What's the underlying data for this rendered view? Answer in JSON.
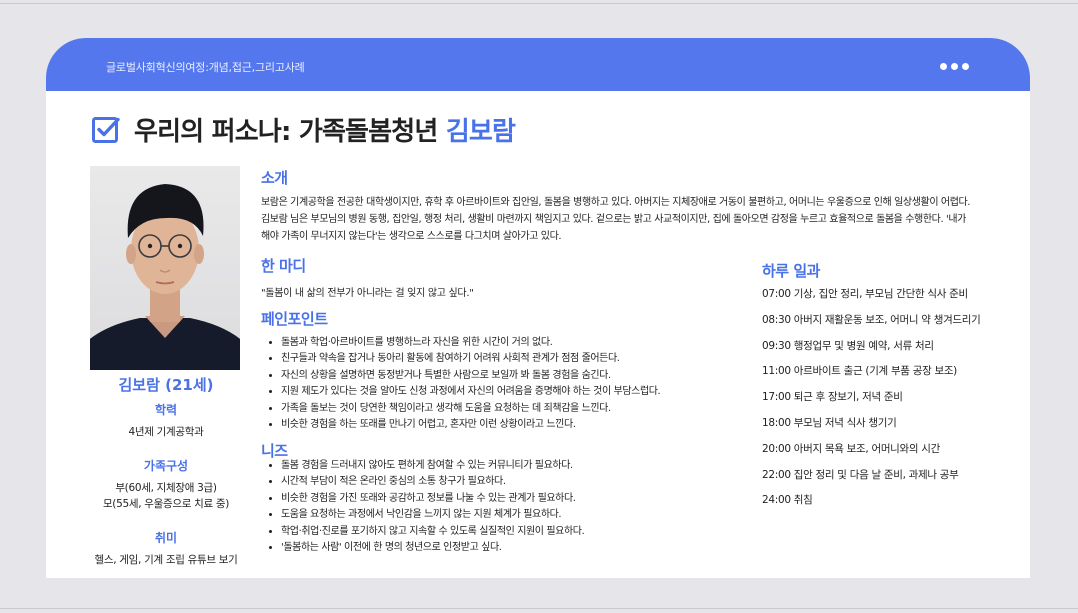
{
  "header": {
    "title": "글로벌사회혁신의여정:개념,접근,그리고사례",
    "menu_icon": "more-dots-icon"
  },
  "page": {
    "title_prefix": "우리의 퍼소나: 가족돌봄청년",
    "title_name": "김보람",
    "title_icon": "checkbox-checked-icon"
  },
  "profile": {
    "name": "김보람 (21세)",
    "education_label": "학력",
    "education": "4년제 기계공학과",
    "family_label": "가족구성",
    "family": [
      "부(60세, 지체장애 3급)",
      "모(55세, 우울증으로 치료 중)"
    ],
    "hobby_label": "취미",
    "hobby": "헬스, 게임, 기계 조립 유튜브 보기"
  },
  "intro": {
    "title": "소개",
    "text": "보람은 기계공학을 전공한 대학생이지만, 휴학 후 아르바이트와 집안일, 돌봄을 병행하고 있다. 아버지는 지체장애로 거동이 불편하고, 어머니는 우울증으로 인해 일상생활이 어렵다. 김보람 님은 부모님의 병원 동행, 집안일, 행정 처리, 생활비 마련까지 책임지고 있다. 겉으로는 밝고 사교적이지만, 집에 돌아오면 감정을 누르고 효율적으로 돌봄을 수행한다. '내가 해야 가족이 무너지지 않는다'는 생각으로 스스로를 다그치며 살아가고 있다."
  },
  "quote": {
    "title": "한 마디",
    "text": "\"돌봄이 내 삶의 전부가 아니라는 걸 잊지 않고 싶다.\""
  },
  "pain_points": {
    "title": "페인포인트",
    "items": [
      "돌봄과 학업·아르바이트를 병행하느라 자신을 위한 시간이 거의 없다.",
      "친구들과 약속을 잡거나 동아리 활동에 참여하기 어려워 사회적 관계가 점점 줄어든다.",
      "자신의 상황을 설명하면 동정받거나 특별한 사람으로 보일까 봐 돌봄 경험을 숨긴다.",
      "지원 제도가 있다는 것을 알아도 신청 과정에서 자신의 어려움을 증명해야 하는 것이 부담스럽다.",
      "가족을 돌보는 것이 당연한 책임이라고 생각해 도움을 요청하는 데 죄책감을 느낀다.",
      "비슷한 경험을 하는 또래를 만나기 어렵고, 혼자만 이런 상황이라고 느낀다."
    ]
  },
  "needs": {
    "title": "니즈",
    "items": [
      "돌봄 경험을 드러내지 않아도 편하게 참여할 수 있는 커뮤니티가 필요하다.",
      "시간적 부담이 적은 온라인 중심의 소통 창구가 필요하다.",
      "비슷한 경험을 가진 또래와 공감하고 정보를 나눌 수 있는 관계가 필요하다.",
      "도움을 요청하는 과정에서 낙인감을 느끼지 않는 지원 체계가 필요하다.",
      "학업·취업·진로를 포기하지 않고 지속할 수 있도록 실질적인 지원이 필요하다.",
      "'돌봄하는 사람' 이전에 한 명의 청년으로 인정받고 싶다."
    ]
  },
  "schedule": {
    "title": "하루 일과",
    "items": [
      "07:00 기상, 집안 정리, 부모님 간단한 식사 준비",
      "08:30 아버지 재활운동 보조, 어머니 약 챙겨드리기",
      "09:30 행정업무 및 병원 예약, 서류 처리",
      "11:00 아르바이트 출근 (기계 부품 공장 보조)",
      "17:00 퇴근 후 장보기, 저녁 준비",
      "18:00 부모님 저녁 식사 챙기기",
      "20:00 아버지 목욕 보조, 어머니와의 시간",
      "22:00 집안 정리 및 다음 날 준비, 과제나 공부",
      "24:00 취침"
    ]
  },
  "colors": {
    "accent": "#4a72e8",
    "header_bg": "#5577ee",
    "page_bg": "#e6e6ea"
  }
}
